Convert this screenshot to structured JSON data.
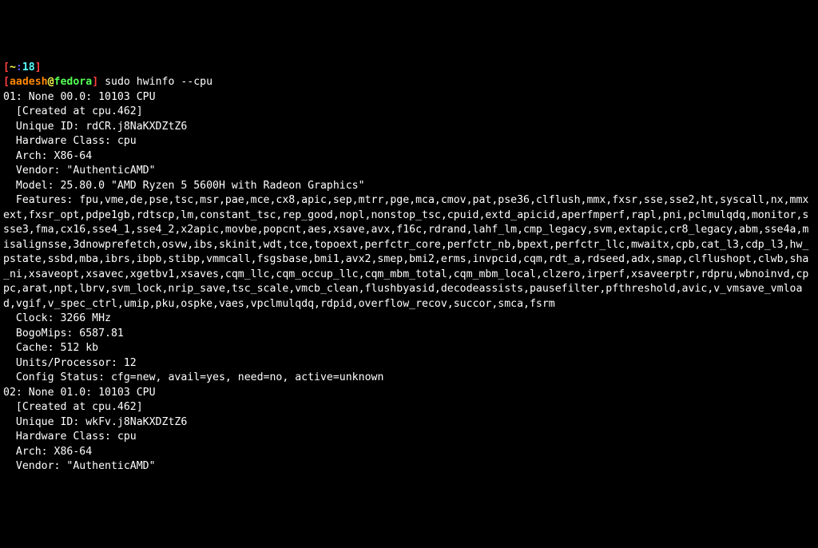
{
  "ps1": {
    "open": "[",
    "tilde": "~",
    "colon": ":",
    "jobnum": "18",
    "close": "]",
    "user": "aadesh",
    "at": "@",
    "host": "fedora",
    "close2": "]",
    "dollar": " "
  },
  "command": "sudo hwinfo --cpu",
  "output": [
    "01: None 00.0: 10103 CPU",
    "  [Created at cpu.462]",
    "  Unique ID: rdCR.j8NaKXDZtZ6",
    "  Hardware Class: cpu",
    "  Arch: X86-64",
    "  Vendor: \"AuthenticAMD\"",
    "  Model: 25.80.0 \"AMD Ryzen 5 5600H with Radeon Graphics\"",
    "  Features: fpu,vme,de,pse,tsc,msr,pae,mce,cx8,apic,sep,mtrr,pge,mca,cmov,pat,pse36,clflush,mmx,fxsr,sse,sse2,ht,syscall,nx,mmxext,fxsr_opt,pdpe1gb,rdtscp,lm,constant_tsc,rep_good,nopl,nonstop_tsc,cpuid,extd_apicid,aperfmperf,rapl,pni,pclmulqdq,monitor,ssse3,fma,cx16,sse4_1,sse4_2,x2apic,movbe,popcnt,aes,xsave,avx,f16c,rdrand,lahf_lm,cmp_legacy,svm,extapic,cr8_legacy,abm,sse4a,misalignsse,3dnowprefetch,osvw,ibs,skinit,wdt,tce,topoext,perfctr_core,perfctr_nb,bpext,perfctr_llc,mwaitx,cpb,cat_l3,cdp_l3,hw_pstate,ssbd,mba,ibrs,ibpb,stibp,vmmcall,fsgsbase,bmi1,avx2,smep,bmi2,erms,invpcid,cqm,rdt_a,rdseed,adx,smap,clflushopt,clwb,sha_ni,xsaveopt,xsavec,xgetbv1,xsaves,cqm_llc,cqm_occup_llc,cqm_mbm_total,cqm_mbm_local,clzero,irperf,xsaveerptr,rdpru,wbnoinvd,cppc,arat,npt,lbrv,svm_lock,nrip_save,tsc_scale,vmcb_clean,flushbyasid,decodeassists,pausefilter,pfthreshold,avic,v_vmsave_vmload,vgif,v_spec_ctrl,umip,pku,ospke,vaes,vpclmulqdq,rdpid,overflow_recov,succor,smca,fsrm",
    "  Clock: 3266 MHz",
    "  BogoMips: 6587.81",
    "  Cache: 512 kb",
    "  Units/Processor: 12",
    "  Config Status: cfg=new, avail=yes, need=no, active=unknown",
    "",
    "02: None 01.0: 10103 CPU",
    "  [Created at cpu.462]",
    "  Unique ID: wkFv.j8NaKXDZtZ6",
    "  Hardware Class: cpu",
    "  Arch: X86-64",
    "  Vendor: \"AuthenticAMD\""
  ]
}
